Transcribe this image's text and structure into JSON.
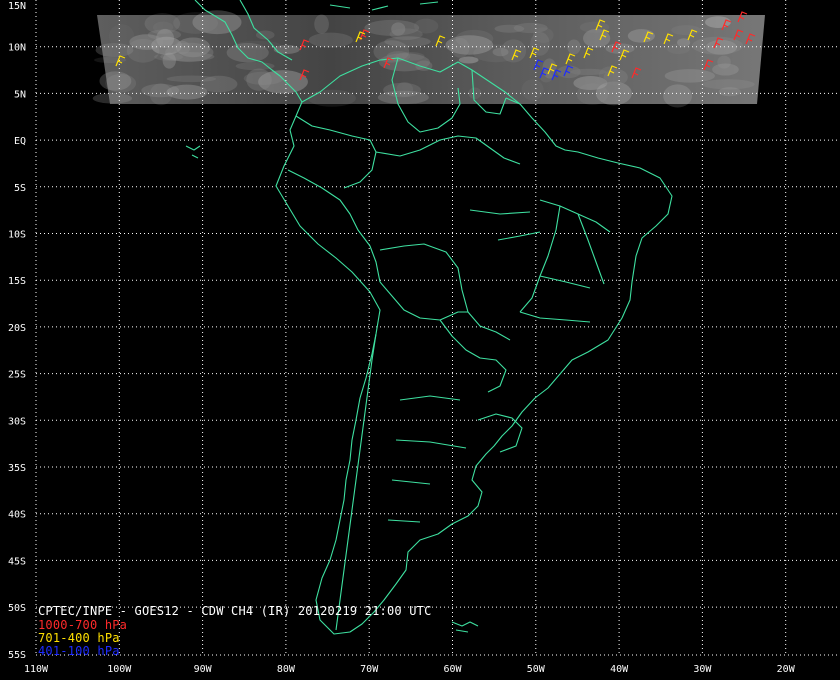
{
  "title": "CPTEC/INPE - GOES12 - CDW CH4 (IR) 20120219 21:00 UTC",
  "legend": [
    {
      "label": "1000-700 hPa",
      "color": "#ff2a2a"
    },
    {
      "label": "701-400 hPa",
      "color": "#ffe000"
    },
    {
      "label": "401-100 hPa",
      "color": "#1e2cff"
    }
  ],
  "lat_labels": [
    "15N",
    "10N",
    "5N",
    "EQ",
    "5S",
    "10S",
    "15S",
    "20S",
    "25S",
    "30S",
    "35S",
    "40S",
    "45S",
    "50S",
    "55S"
  ],
  "lon_labels": [
    "110W",
    "100W",
    "90W",
    "80W",
    "70W",
    "60W",
    "50W",
    "40W",
    "30W",
    "20W"
  ],
  "colors": {
    "background": "#000000",
    "coastline": "#3ee0a0",
    "gridlines": "#ffffff",
    "ir_strip": "#6a6a6a"
  }
}
